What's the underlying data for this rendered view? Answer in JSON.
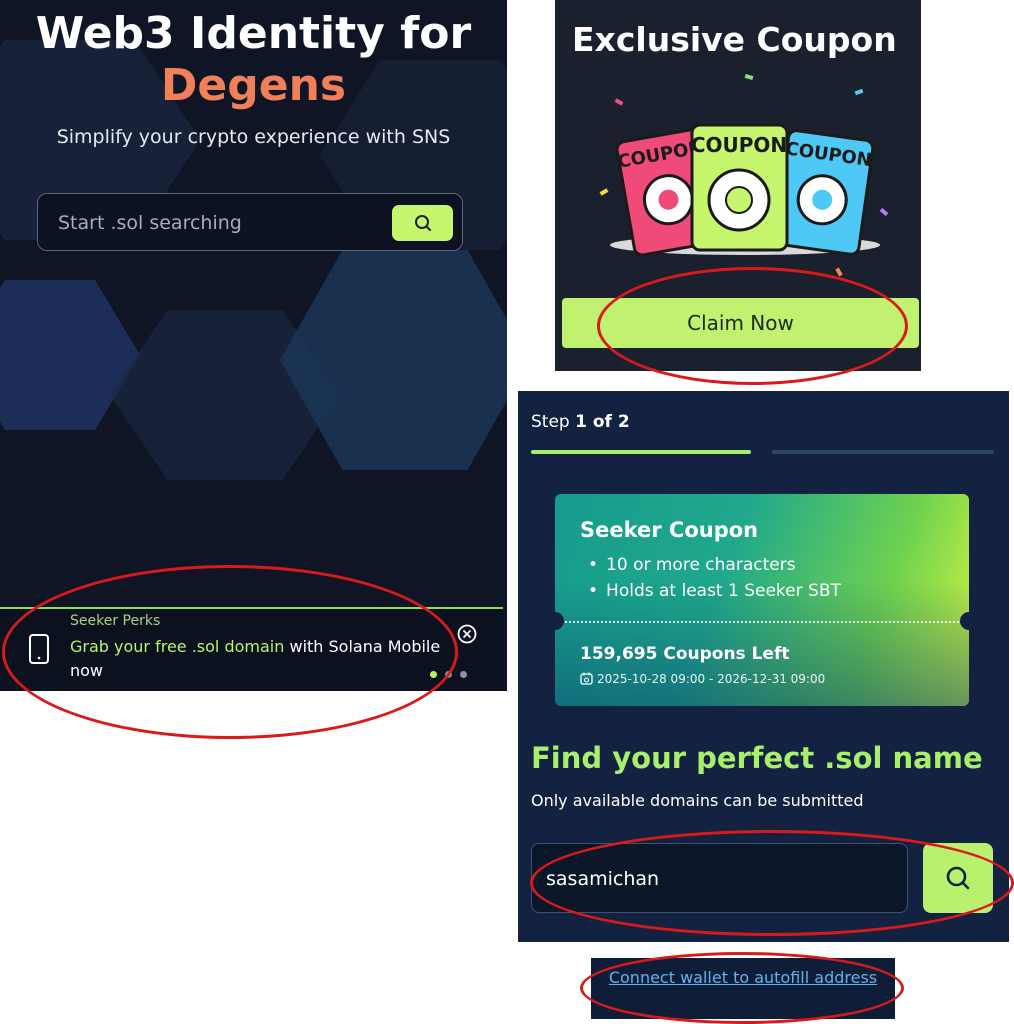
{
  "left_panel": {
    "title_line1": "Web3 Identity for",
    "title_line2": "Degens",
    "subtitle": "Simplify your crypto experience with SNS",
    "search_placeholder": "Start .sol searching",
    "banner": {
      "eyebrow": "Seeker Perks",
      "text_highlight": "Grab your free .sol domain",
      "text_rest": " with Solana Mobile now",
      "pager_active_index": 0,
      "pager_count": 3
    }
  },
  "coupon_card": {
    "title": "Exclusive Coupon",
    "ticket_label": "COUPON",
    "claim_label": "Claim Now"
  },
  "step_panel": {
    "step_prefix": "Step ",
    "step_value": "1 of 2",
    "seeker_coupon": {
      "title": "Seeker Coupon",
      "requirements": [
        "10 or more characters",
        "Holds at least 1 Seeker SBT"
      ],
      "coupons_left": "159,695 Coupons Left",
      "date_range": "2025-10-28 09:00 - 2026-12-31 09:00"
    },
    "heading": "Find your perfect .sol name",
    "note": "Only available domains can be submitted",
    "domain_value": "sasamichan"
  },
  "connect_link": "Connect wallet to autofill address",
  "colors": {
    "accent_green": "#b7f16d",
    "accent_orange": "#f0805a",
    "annotation_red": "#d91a1a",
    "link_blue": "#5fb4ef"
  }
}
